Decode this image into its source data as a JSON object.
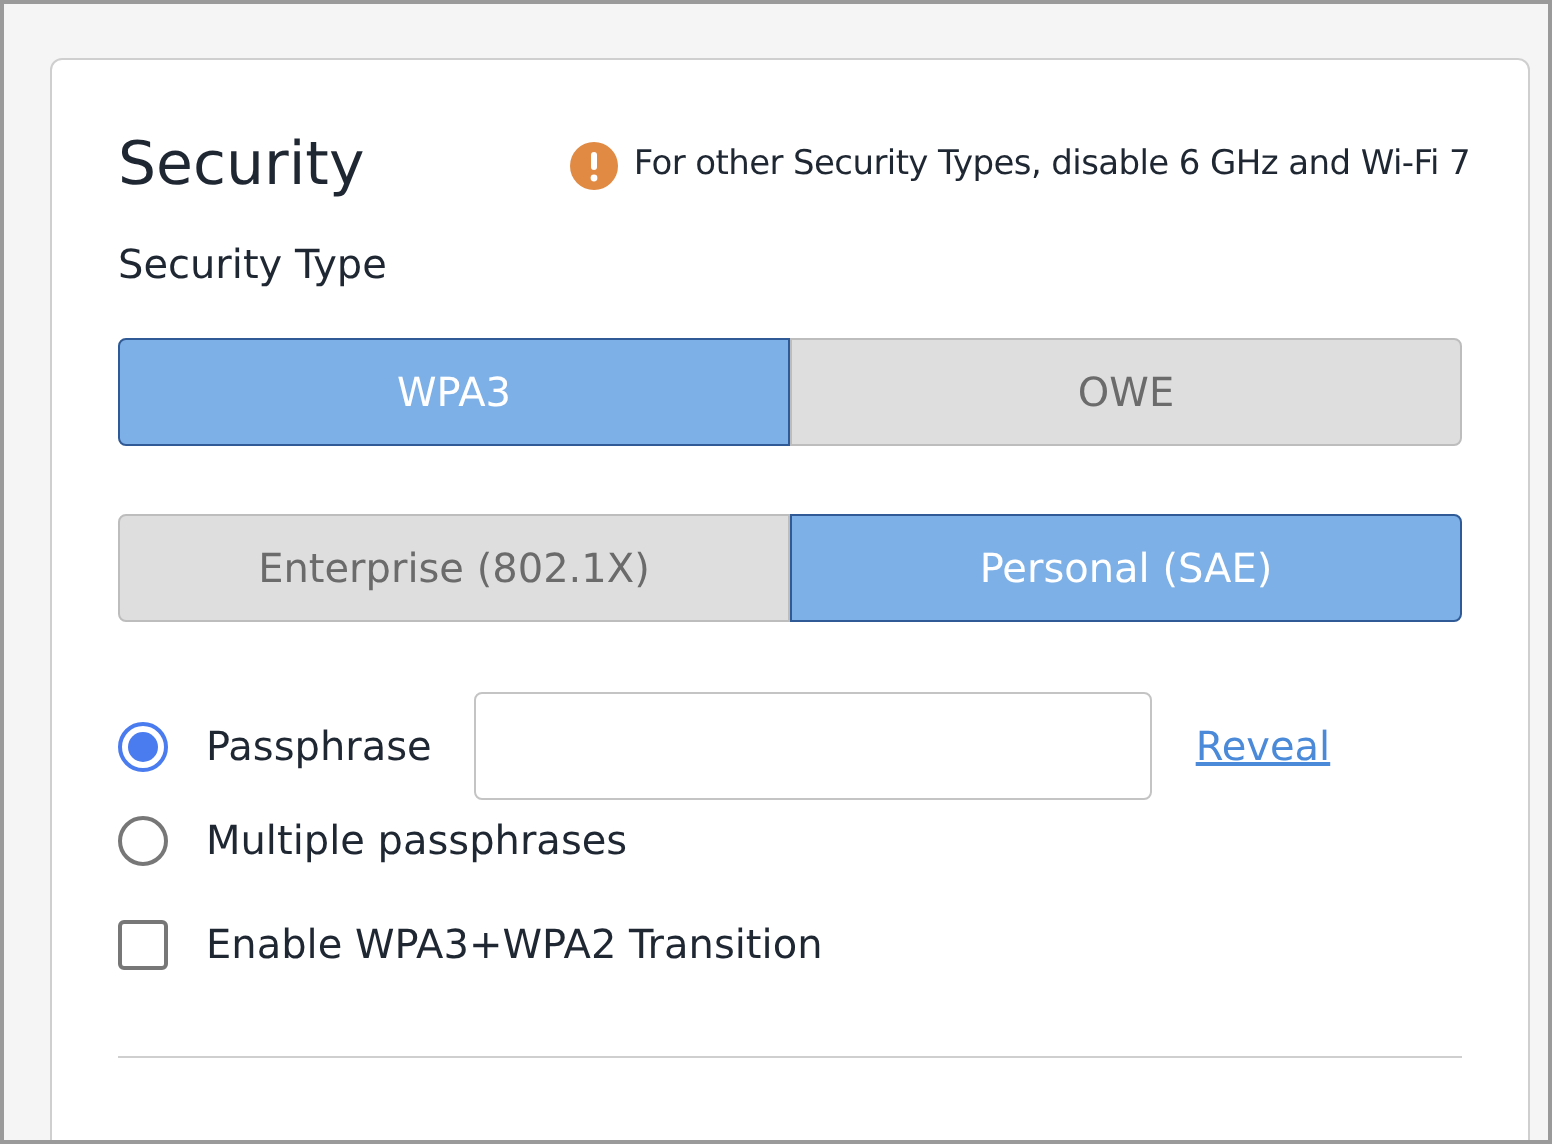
{
  "section": {
    "title": "Security",
    "notice": "For other Security Types, disable 6 GHz and Wi-Fi 7"
  },
  "security_type": {
    "label": "Security Type",
    "types": [
      {
        "label": "WPA3",
        "selected": true
      },
      {
        "label": "OWE",
        "selected": false
      }
    ],
    "modes": [
      {
        "label": "Enterprise (802.1X)",
        "selected": false
      },
      {
        "label": "Personal (SAE)",
        "selected": true
      }
    ]
  },
  "passphrase_options": [
    {
      "label": "Passphrase",
      "selected": true,
      "kind": "with_field",
      "link": "Reveal"
    },
    {
      "label": "Multiple passphrases",
      "selected": false,
      "kind": "plain"
    }
  ],
  "transition": {
    "label": "Enable WPA3+WPA2 Transition",
    "checked": false
  }
}
